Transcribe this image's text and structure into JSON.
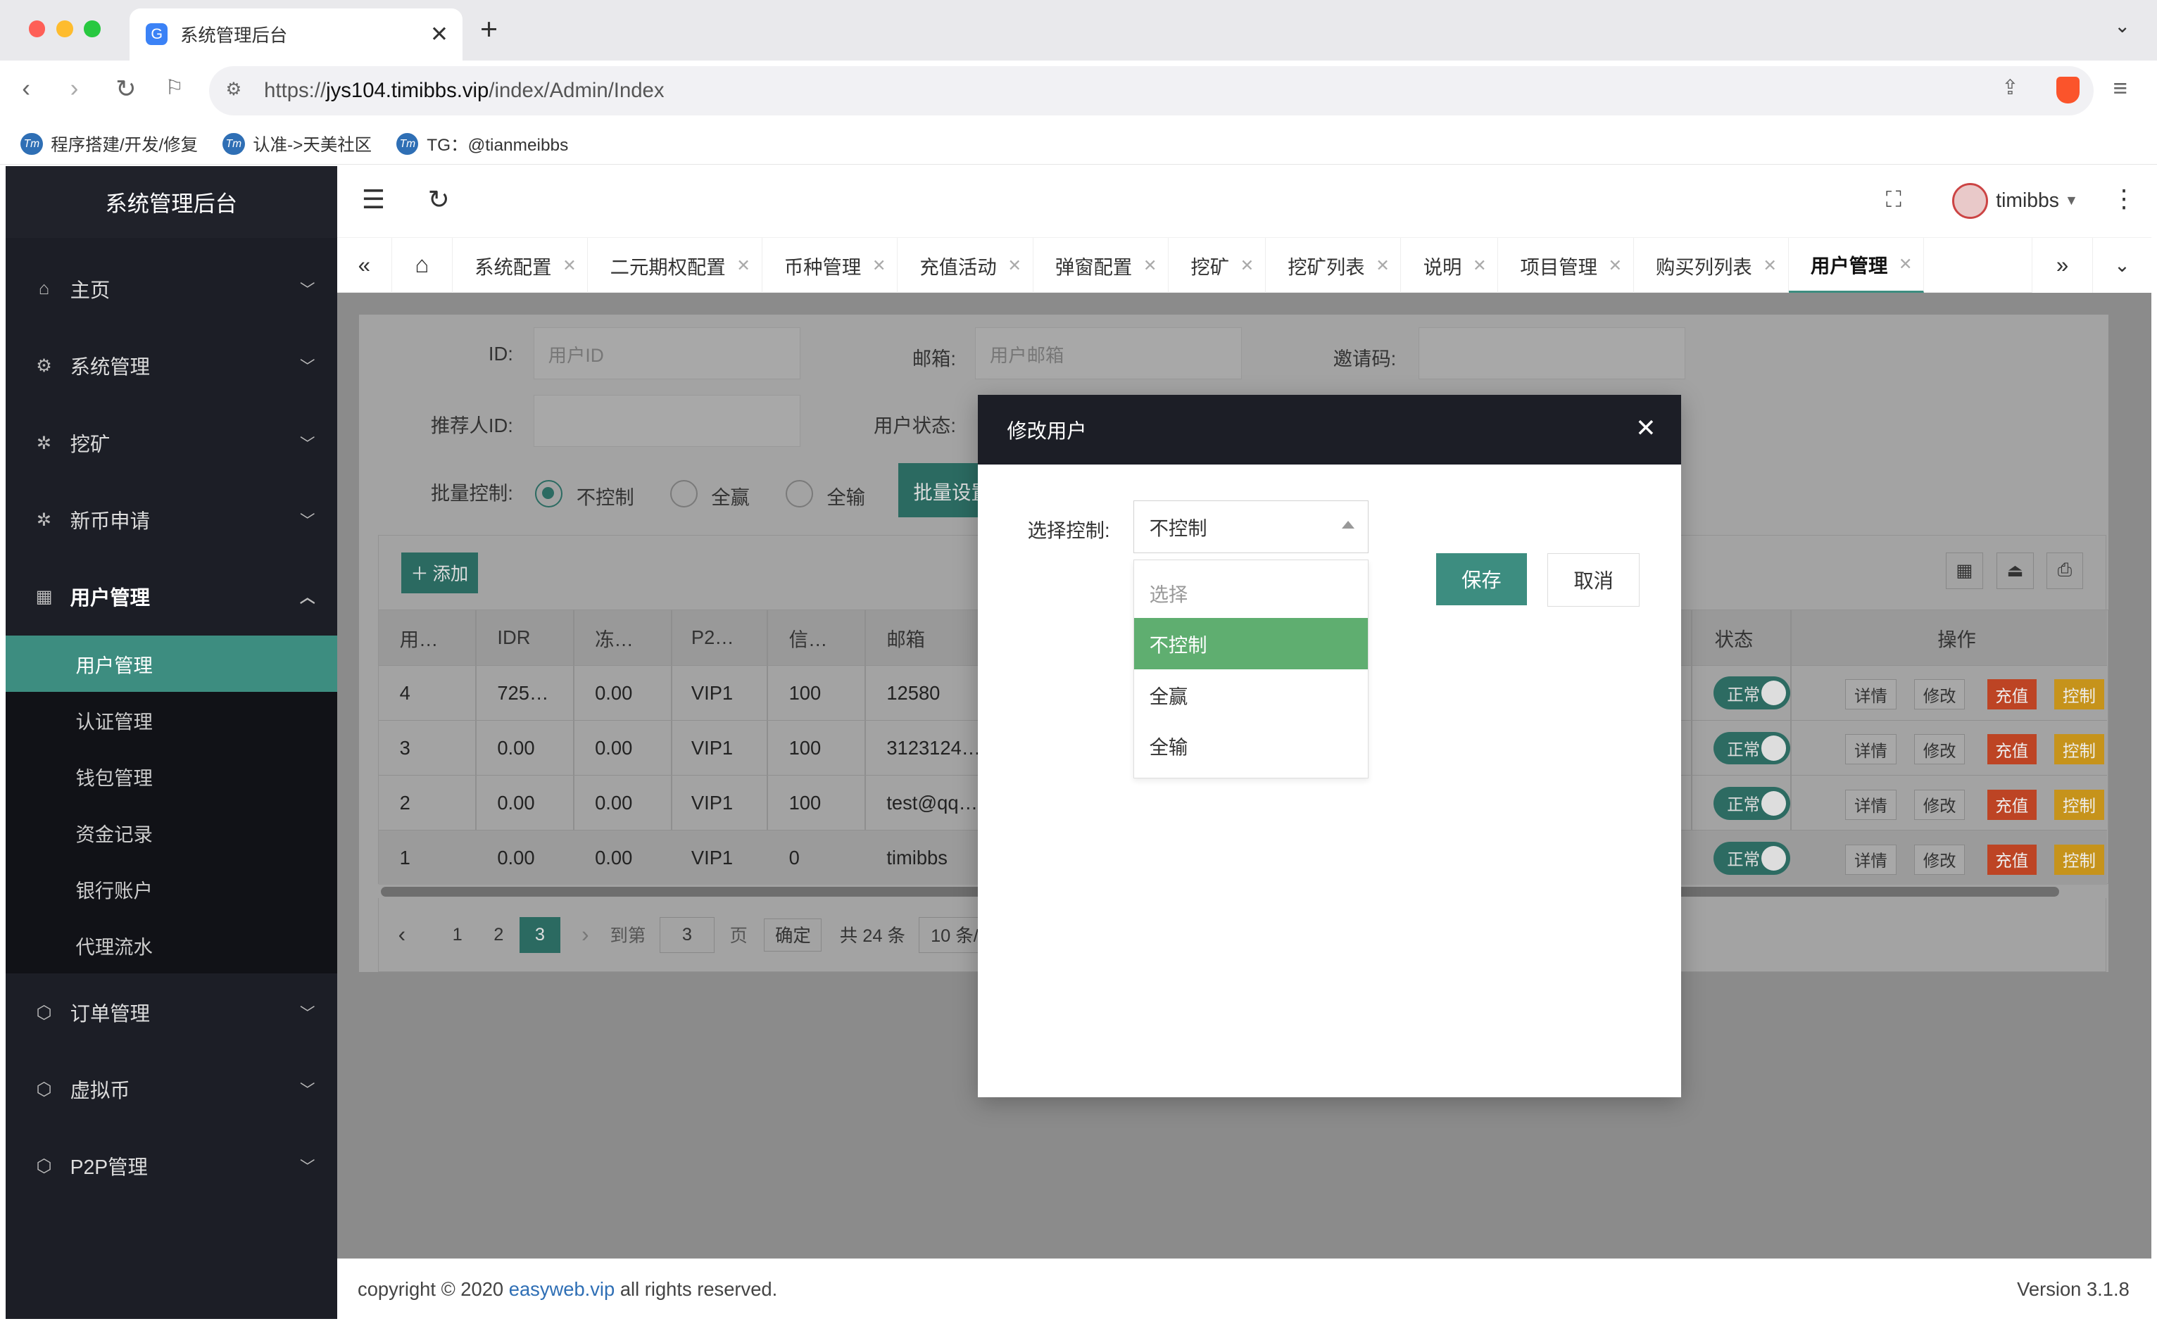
{
  "browser": {
    "tab_title": "系统管理后台",
    "tab_favicon": "G",
    "url_prefix": "https://",
    "url_host": "jys104.timibbs.vip",
    "url_path": "/index/Admin/Index",
    "bookmarks": [
      {
        "label": "程序搭建/开发/修复",
        "icon": "Tm"
      },
      {
        "label": "认准->天美社区",
        "icon": "Tm"
      },
      {
        "label": "TG：@tianmeibbs",
        "icon": "Tm"
      }
    ]
  },
  "sidebar": {
    "title": "系统管理后台",
    "menus_top": [
      {
        "label": "主页",
        "icon": "home-icon"
      },
      {
        "label": "系统管理",
        "icon": "gear-icon"
      },
      {
        "label": "挖矿",
        "icon": "bug-icon"
      },
      {
        "label": "新币申请",
        "icon": "bug-icon"
      }
    ],
    "open_menu": {
      "label": "用户管理",
      "icon": "building-icon"
    },
    "sub_items": [
      "用户管理",
      "认证管理",
      "钱包管理",
      "资金记录",
      "银行账户",
      "代理流水"
    ],
    "active_sub": "用户管理",
    "menus_bottom": [
      {
        "label": "订单管理",
        "icon": "cube-icon"
      },
      {
        "label": "虚拟币",
        "icon": "cube-icon"
      },
      {
        "label": "P2P管理",
        "icon": "cube-icon"
      }
    ]
  },
  "header": {
    "username": "timibbs"
  },
  "page_tabs": [
    "系统配置",
    "二元期权配置",
    "币种管理",
    "充值活动",
    "弹窗配置",
    "挖矿",
    "挖矿列表",
    "说明",
    "项目管理",
    "购买列列表",
    "用户管理"
  ],
  "active_page_tab": "用户管理",
  "filters": {
    "id_label": "ID:",
    "id_placeholder": "用户ID",
    "email_label": "邮箱:",
    "email_placeholder": "用户邮箱",
    "invite_label": "邀请码:",
    "referrer_label": "推荐人ID:",
    "status_label": "用户状态:",
    "batch_label": "批量控制:",
    "batch_options": [
      "不控制",
      "全赢",
      "全输"
    ],
    "batch_selected": "不控制",
    "batch_button": "批量设置"
  },
  "table": {
    "add_button": "添加",
    "headers": [
      "用…",
      "IDR",
      "冻…",
      "P2…",
      "信…",
      "邮箱",
      "状态",
      "操作"
    ],
    "rows": [
      {
        "id": "4",
        "idr": "725…",
        "frozen": "0.00",
        "p2p": "VIP1",
        "credit": "100",
        "email": "12580",
        "status": "正常"
      },
      {
        "id": "3",
        "idr": "0.00",
        "frozen": "0.00",
        "p2p": "VIP1",
        "credit": "100",
        "email": "3123124…",
        "status": "正常"
      },
      {
        "id": "2",
        "idr": "0.00",
        "frozen": "0.00",
        "p2p": "VIP1",
        "credit": "100",
        "email": "test@qq…",
        "status": "正常"
      },
      {
        "id": "1",
        "idr": "0.00",
        "frozen": "0.00",
        "p2p": "VIP1",
        "credit": "0",
        "email": "timibbs",
        "status": "正常"
      }
    ],
    "actions": [
      "详情",
      "修改",
      "充值",
      "控制"
    ]
  },
  "pagination": {
    "pages": [
      "1",
      "2",
      "3"
    ],
    "current": "3",
    "goto_label": "到第",
    "goto_value": "3",
    "page_unit": "页",
    "confirm": "确定",
    "total": "共 24 条",
    "per_page": "10 条/"
  },
  "footer": {
    "copyright_prefix": "copyright © 2020 ",
    "link": "easyweb.vip",
    "copyright_suffix": " all rights reserved.",
    "version": "Version 3.1.8"
  },
  "modal": {
    "title": "修改用户",
    "field_label": "选择控制:",
    "select_value": "不控制",
    "options": [
      "选择",
      "不控制",
      "全赢",
      "全输"
    ],
    "selected_option": "不控制",
    "save": "保存",
    "cancel": "取消"
  },
  "colors": {
    "primary": "#3d8d80",
    "sidebar_bg": "#1c1e26",
    "dropdown_selected": "#5fae70",
    "recharge": "#e7532b",
    "control": "#f5b120"
  }
}
